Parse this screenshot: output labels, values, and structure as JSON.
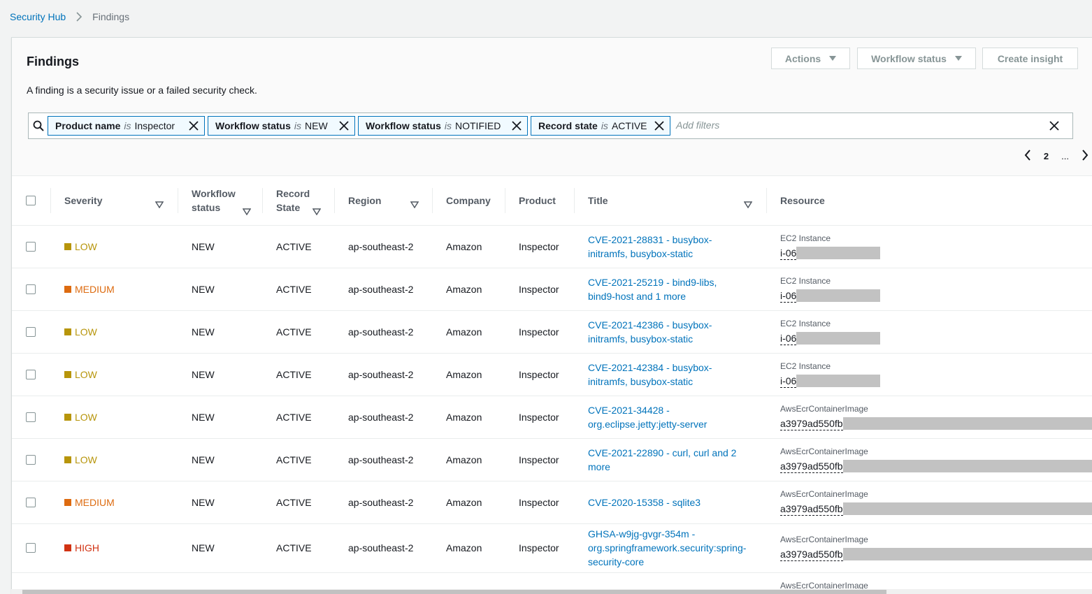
{
  "breadcrumb": {
    "root": "Security Hub",
    "current": "Findings"
  },
  "panel": {
    "title": "Findings",
    "description": "A finding is a security issue or a failed security check.",
    "actions_label": "Actions",
    "workflow_label": "Workflow status",
    "insight_label": "Create insight"
  },
  "filters": {
    "tokens": [
      {
        "key": "Product name",
        "op": "is",
        "value": "Inspector"
      },
      {
        "key": "Workflow status",
        "op": "is",
        "value": "NEW"
      },
      {
        "key": "Workflow status",
        "op": "is",
        "value": "NOTIFIED"
      },
      {
        "key": "Record state",
        "op": "is",
        "value": "ACTIVE"
      }
    ],
    "placeholder": "Add filters"
  },
  "pager": {
    "page": "2",
    "ellipsis": "..."
  },
  "table": {
    "headers": {
      "severity": "Severity",
      "workflow_1": "Workflow",
      "workflow_2": "status",
      "record_1": "Record",
      "record_2": "State",
      "region": "Region",
      "company": "Company",
      "product": "Product",
      "title": "Title",
      "resource": "Resource"
    },
    "rows": [
      {
        "severity": "LOW",
        "sev_color": "#b7950b",
        "workflow": "NEW",
        "record": "ACTIVE",
        "region": "ap-southeast-2",
        "company": "Amazon",
        "product": "Inspector",
        "title": [
          "CVE-2021-28831 - busybox-",
          "initramfs, busybox-static"
        ],
        "res_type": "EC2 Instance",
        "res_id": "i-06"
      },
      {
        "severity": "MEDIUM",
        "sev_color": "#dd6b10",
        "workflow": "NEW",
        "record": "ACTIVE",
        "region": "ap-southeast-2",
        "company": "Amazon",
        "product": "Inspector",
        "title": [
          "CVE-2021-25219 - bind9-libs,",
          "bind9-host and 1 more"
        ],
        "res_type": "EC2 Instance",
        "res_id": "i-06"
      },
      {
        "severity": "LOW",
        "sev_color": "#b7950b",
        "workflow": "NEW",
        "record": "ACTIVE",
        "region": "ap-southeast-2",
        "company": "Amazon",
        "product": "Inspector",
        "title": [
          "CVE-2021-42386 - busybox-",
          "initramfs, busybox-static"
        ],
        "res_type": "EC2 Instance",
        "res_id": "i-06"
      },
      {
        "severity": "LOW",
        "sev_color": "#b7950b",
        "workflow": "NEW",
        "record": "ACTIVE",
        "region": "ap-southeast-2",
        "company": "Amazon",
        "product": "Inspector",
        "title": [
          "CVE-2021-42384 - busybox-",
          "initramfs, busybox-static"
        ],
        "res_type": "EC2 Instance",
        "res_id": "i-06"
      },
      {
        "severity": "LOW",
        "sev_color": "#b7950b",
        "workflow": "NEW",
        "record": "ACTIVE",
        "region": "ap-southeast-2",
        "company": "Amazon",
        "product": "Inspector",
        "title": [
          "CVE-2021-34428 -",
          "org.eclipse.jetty:jetty-server"
        ],
        "res_type": "AwsEcrContainerImage",
        "res_id": "a3979ad550fb"
      },
      {
        "severity": "LOW",
        "sev_color": "#b7950b",
        "workflow": "NEW",
        "record": "ACTIVE",
        "region": "ap-southeast-2",
        "company": "Amazon",
        "product": "Inspector",
        "title": [
          "CVE-2021-22890 - curl, curl and 2",
          "more"
        ],
        "res_type": "AwsEcrContainerImage",
        "res_id": "a3979ad550fb"
      },
      {
        "severity": "MEDIUM",
        "sev_color": "#dd6b10",
        "workflow": "NEW",
        "record": "ACTIVE",
        "region": "ap-southeast-2",
        "company": "Amazon",
        "product": "Inspector",
        "title": [
          "CVE-2020-15358 - sqlite3"
        ],
        "res_type": "AwsEcrContainerImage",
        "res_id": "a3979ad550fb"
      },
      {
        "severity": "HIGH",
        "sev_color": "#d13212",
        "workflow": "NEW",
        "record": "ACTIVE",
        "region": "ap-southeast-2",
        "company": "Amazon",
        "product": "Inspector",
        "title": [
          "GHSA-w9jg-gvgr-354m -",
          "org.springframework.security:spring-",
          "security-core"
        ],
        "res_type": "AwsEcrContainerImage",
        "res_id": "a3979ad550fb"
      },
      {
        "severity": "",
        "sev_color": "#b7950b",
        "workflow": "",
        "record": "",
        "region": "",
        "company": "",
        "product": "",
        "title": [],
        "res_type": "AwsEcrContainerImage",
        "res_id": ""
      }
    ]
  }
}
